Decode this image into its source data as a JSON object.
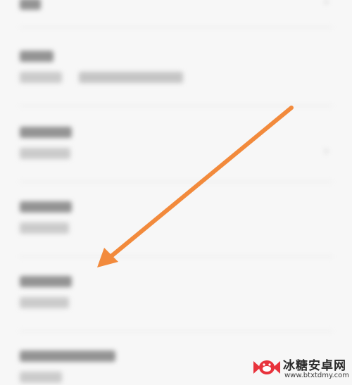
{
  "watermark": {
    "title": "冰糖安卓网",
    "url": "www.btxtdmy.com"
  },
  "colors": {
    "arrow": "#f28a3c",
    "background": "#f7f7f7",
    "logo_red": "#e8333c"
  },
  "icons": [
    "chevron-right-icon",
    "arrow-icon",
    "candy-logo-icon"
  ]
}
